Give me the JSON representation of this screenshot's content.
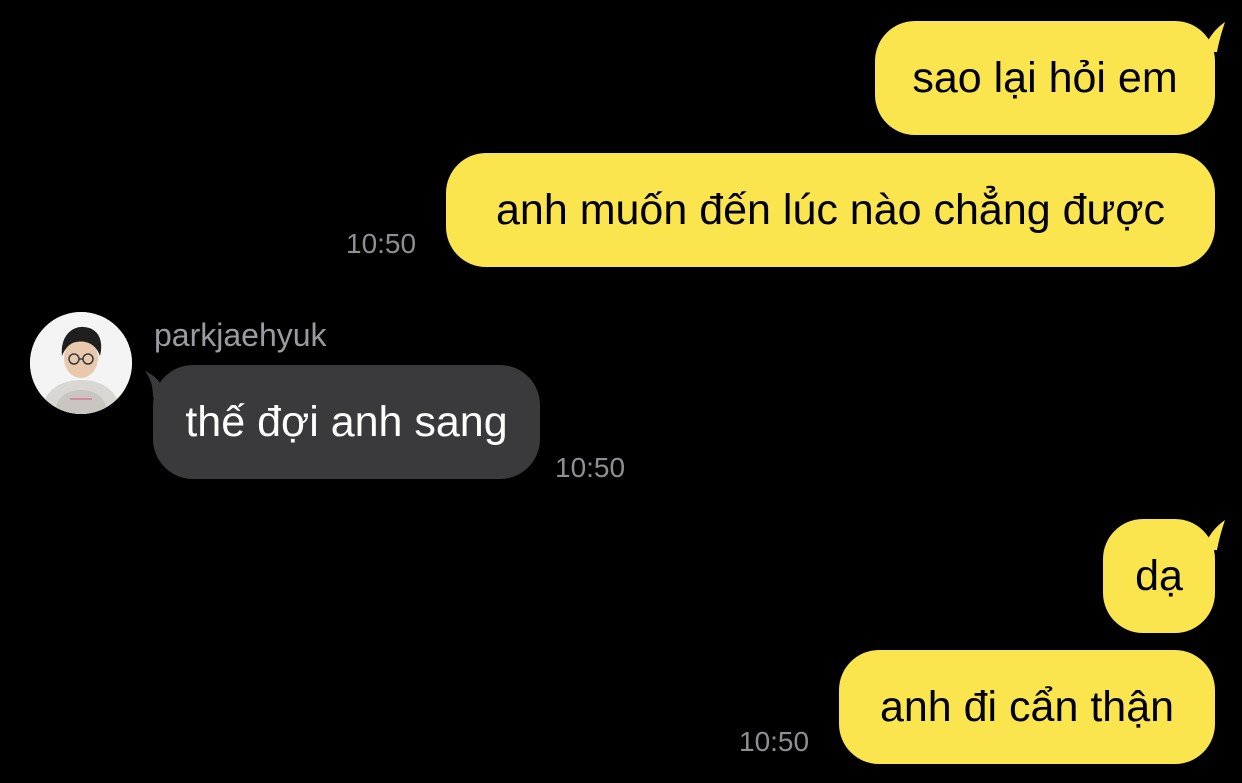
{
  "messages": [
    {
      "direction": "out",
      "text": "sao lại hỏi em"
    },
    {
      "direction": "out",
      "text": "anh muốn đến lúc nào chẳng được",
      "time": "10:50"
    },
    {
      "direction": "in",
      "sender": "parkjaehyuk",
      "text": "thế đợi anh sang",
      "time": "10:50"
    },
    {
      "direction": "out",
      "text": "dạ"
    },
    {
      "direction": "out",
      "text": "anh đi cẩn thận",
      "time": "10:50"
    }
  ],
  "colors": {
    "background": "#000000",
    "outgoing_bubble": "#fbe54e",
    "incoming_bubble": "#3a3a3c",
    "timestamp": "#8e8e93"
  },
  "icons": {
    "avatar": "user-avatar-photo"
  }
}
